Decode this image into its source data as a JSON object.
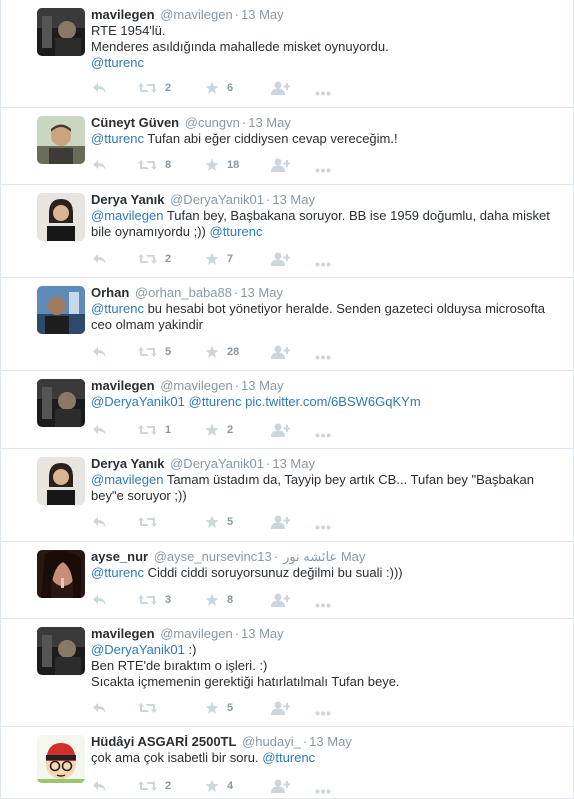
{
  "icons": {
    "reply": "reply-icon",
    "retweet": "retweet-icon",
    "favorite": "star-icon",
    "follow": "follow-user-icon",
    "more": "more-options-icon"
  },
  "colors": {
    "link": "#2f7bb8",
    "muted": "#8899a6",
    "icon": "#ccd6dd",
    "divider": "#e1e8ed"
  },
  "tweets": [
    {
      "fullname": "mavilegen",
      "username": "@mavilegen",
      "time": "13 May",
      "lines": [
        [
          {
            "t": "RTE 1954'lü."
          }
        ],
        [
          {
            "t": "Menderes asıldığında mahallede misket oynuyordu."
          }
        ],
        [
          {
            "t": "@tturenc",
            "m": true
          }
        ]
      ],
      "retweets": "2",
      "favorites": "6"
    },
    {
      "fullname": "Cüneyt Güven",
      "username": "@cungvn",
      "time": "13 May",
      "lines": [
        [
          {
            "t": "@tturenc",
            "m": true
          },
          {
            "t": " Tufan abi eğer ciddiysen cevap vereceğim.!"
          }
        ]
      ],
      "retweets": "8",
      "favorites": "18"
    },
    {
      "fullname": "Derya Yanık",
      "username": "@DeryaYanik01",
      "time": "13 May",
      "lines": [
        [
          {
            "t": "@mavilegen",
            "m": true
          },
          {
            "t": " Tufan bey, Başbakana soruyor. BB ise 1959 doğumlu, daha misket"
          }
        ],
        [
          {
            "t": "bile oynamıyordu ;)) "
          },
          {
            "t": "@tturenc",
            "m": true
          }
        ]
      ],
      "retweets": "2",
      "favorites": "7"
    },
    {
      "fullname": "Orhan",
      "username": "@orhan_baba88",
      "time": "13 May",
      "lines": [
        [
          {
            "t": "@tturenc",
            "m": true
          },
          {
            "t": " bu hesabi bot yönetiyor heralde. Senden gazeteci olduysa microsofta"
          }
        ],
        [
          {
            "t": "ceo olmam yakindir"
          }
        ]
      ],
      "retweets": "5",
      "favorites": "28"
    },
    {
      "fullname": "mavilegen",
      "username": "@mavilegen",
      "time": "13 May",
      "lines": [
        [
          {
            "t": "@DeryaYanik01",
            "m": true
          },
          {
            "t": " "
          },
          {
            "t": "@tturenc",
            "m": true
          },
          {
            "t": " "
          },
          {
            "t": "pic.twitter.com/6BSW6GqKYm",
            "m": true
          }
        ]
      ],
      "retweets": "1",
      "favorites": "2"
    },
    {
      "fullname": "Derya Yanık",
      "username": "@DeryaYanik01",
      "time": "13 May",
      "lines": [
        [
          {
            "t": "@mavilegen",
            "m": true
          },
          {
            "t": " Tamam üstadım da, Tayyip bey artık CB... Tufan bey \"Başbakan"
          }
        ],
        [
          {
            "t": "bey\"e soruyor ;))"
          }
        ]
      ],
      "retweets": "",
      "favorites": "5"
    },
    {
      "fullname": "ayse_nur",
      "username": "@ayse_nursevinc",
      "rtlname": "عائشه نور",
      "time": "13 May",
      "lines": [
        [
          {
            "t": "@tturenc",
            "m": true
          },
          {
            "t": " Ciddi ciddi soruyorsunuz değilmi bu suali :)))"
          }
        ]
      ],
      "retweets": "3",
      "favorites": "8"
    },
    {
      "fullname": "mavilegen",
      "username": "@mavilegen",
      "time": "13 May",
      "lines": [
        [
          {
            "t": "@DeryaYanik01",
            "m": true
          },
          {
            "t": " :)"
          }
        ],
        [
          {
            "t": "Ben RTE'de bıraktım o işleri. :)"
          }
        ],
        [
          {
            "t": "Sıcakta içmemenin gerektiği hatırlatılmalı Tufan beye."
          }
        ]
      ],
      "retweets": "",
      "favorites": "5"
    },
    {
      "fullname": "Hüdâyi ASGARİ 2500TL",
      "username": "@hudayi_",
      "time": "13 May",
      "lines": [
        [
          {
            "t": "çok ama çok isabetli bir soru. "
          },
          {
            "t": "@tturenc",
            "m": true
          }
        ]
      ],
      "retweets": "2",
      "favorites": "4"
    }
  ]
}
